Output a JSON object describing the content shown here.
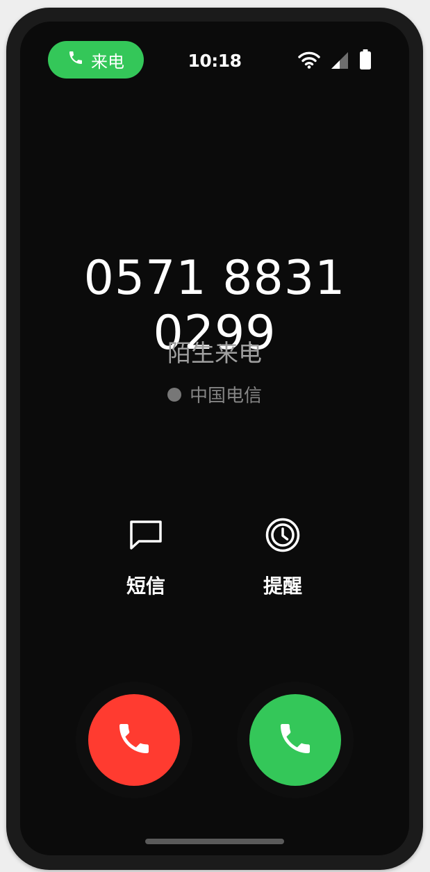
{
  "status_bar": {
    "call_pill_label": "来电",
    "time": "10:18",
    "icons": [
      "wifi-icon",
      "cellular-signal-icon",
      "battery-icon"
    ]
  },
  "caller": {
    "number": "0571 8831 0299",
    "label": "陌生来电",
    "carrier": "中国电信"
  },
  "actions": {
    "sms_label": "短信",
    "remind_label": "提醒"
  },
  "call_buttons": {
    "decline_icon": "phone-decline-icon",
    "accept_icon": "phone-accept-icon"
  },
  "colors": {
    "accept_green": "#34c759",
    "decline_red": "#ff3b30",
    "screen_bg": "#0b0b0b"
  }
}
